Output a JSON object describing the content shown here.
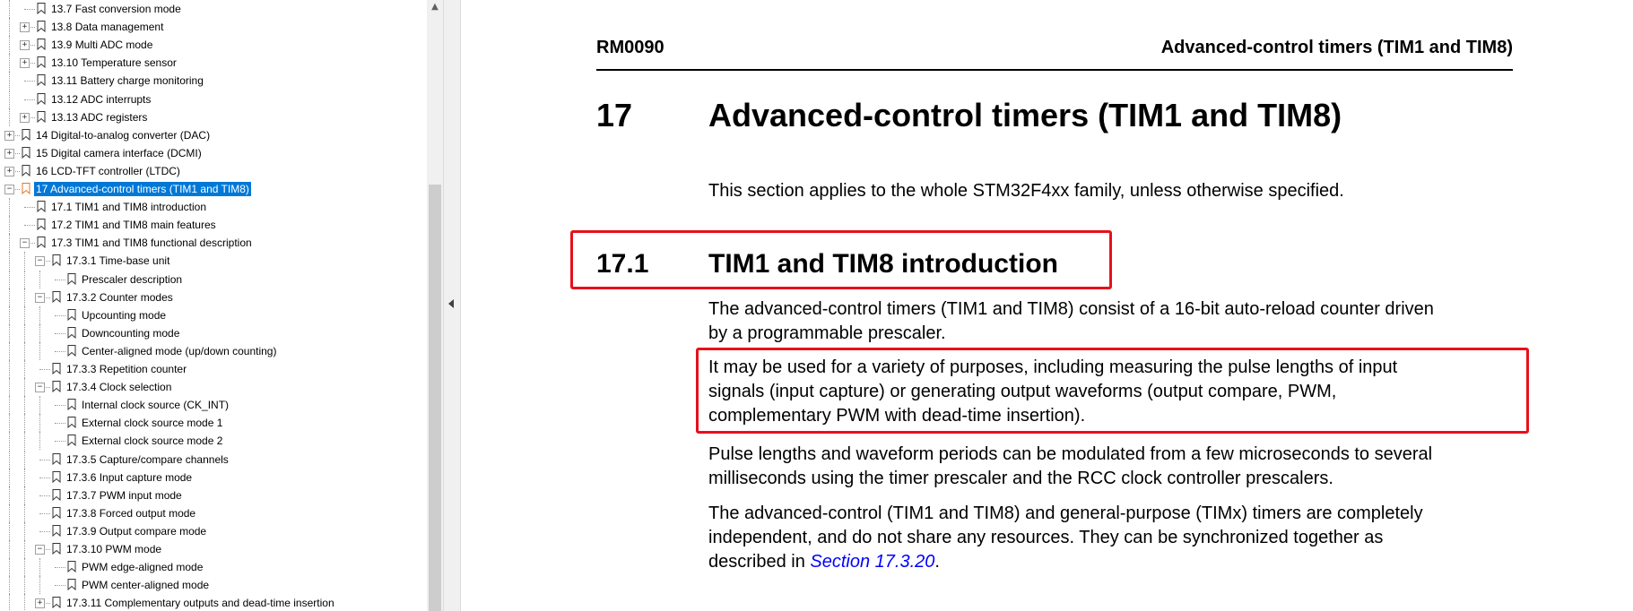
{
  "sidebar": {
    "items": [
      {
        "label": "13.7 Fast conversion mode",
        "level": 2,
        "expandable": false
      },
      {
        "label": "13.8 Data management",
        "level": 2,
        "expandable": true
      },
      {
        "label": "13.9 Multi ADC mode",
        "level": 2,
        "expandable": true
      },
      {
        "label": "13.10 Temperature sensor",
        "level": 2,
        "expandable": true
      },
      {
        "label": "13.11 Battery charge monitoring",
        "level": 2,
        "expandable": false
      },
      {
        "label": "13.12 ADC interrupts",
        "level": 2,
        "expandable": false
      },
      {
        "label": "13.13 ADC registers",
        "level": 2,
        "expandable": true
      },
      {
        "label": "14 Digital-to-analog converter (DAC)",
        "level": 1,
        "expandable": true
      },
      {
        "label": "15 Digital camera interface (DCMI)",
        "level": 1,
        "expandable": true
      },
      {
        "label": "16 LCD-TFT controller (LTDC)",
        "level": 1,
        "expandable": true
      },
      {
        "label": "17 Advanced-control timers (TIM1 and TIM8)",
        "level": 1,
        "expandable": true,
        "expanded": true,
        "selected": true
      },
      {
        "label": "17.1 TIM1 and TIM8 introduction",
        "level": 2,
        "expandable": false
      },
      {
        "label": "17.2 TIM1 and TIM8 main features",
        "level": 2,
        "expandable": false
      },
      {
        "label": "17.3 TIM1 and TIM8 functional description",
        "level": 2,
        "expandable": true,
        "expanded": true
      },
      {
        "label": "17.3.1 Time-base unit",
        "level": 3,
        "expandable": true,
        "expanded": true
      },
      {
        "label": "Prescaler description",
        "level": 4,
        "expandable": false
      },
      {
        "label": "17.3.2 Counter modes",
        "level": 3,
        "expandable": true,
        "expanded": true
      },
      {
        "label": "Upcounting mode",
        "level": 4,
        "expandable": false
      },
      {
        "label": "Downcounting mode",
        "level": 4,
        "expandable": false
      },
      {
        "label": "Center-aligned mode (up/down counting)",
        "level": 4,
        "expandable": false
      },
      {
        "label": "17.3.3 Repetition counter",
        "level": 3,
        "expandable": false
      },
      {
        "label": "17.3.4 Clock selection",
        "level": 3,
        "expandable": true,
        "expanded": true
      },
      {
        "label": "Internal clock source (CK_INT)",
        "level": 4,
        "expandable": false
      },
      {
        "label": "External clock source mode 1",
        "level": 4,
        "expandable": false
      },
      {
        "label": "External clock source mode 2",
        "level": 4,
        "expandable": false
      },
      {
        "label": "17.3.5 Capture/compare channels",
        "level": 3,
        "expandable": false
      },
      {
        "label": "17.3.6 Input capture mode",
        "level": 3,
        "expandable": false
      },
      {
        "label": "17.3.7 PWM input mode",
        "level": 3,
        "expandable": false
      },
      {
        "label": "17.3.8 Forced output mode",
        "level": 3,
        "expandable": false
      },
      {
        "label": "17.3.9 Output compare mode",
        "level": 3,
        "expandable": false
      },
      {
        "label": "17.3.10 PWM mode",
        "level": 3,
        "expandable": true,
        "expanded": true
      },
      {
        "label": "PWM edge-aligned mode",
        "level": 4,
        "expandable": false
      },
      {
        "label": "PWM center-aligned mode",
        "level": 4,
        "expandable": false
      },
      {
        "label": "17.3.11 Complementary outputs and dead-time insertion",
        "level": 3,
        "expandable": true
      }
    ],
    "selected_color": "#0078d7",
    "selected_icon_color": "#e87722"
  },
  "document": {
    "header_left": "RM0090",
    "header_right": "Advanced-control timers (TIM1 and TIM8)",
    "chapter_number": "17",
    "chapter_title": "Advanced-control timers (TIM1 and TIM8)",
    "chapter_intro": "This section applies to the whole STM32F4xx family, unless otherwise specified.",
    "section_number": "17.1",
    "section_title": "TIM1 and TIM8 introduction",
    "paragraphs": {
      "p1": [
        "The advanced-control timers (TIM1 and TIM8) consist of a 16-bit auto-reload counter driven",
        "by a programmable prescaler."
      ],
      "p2": [
        "It may be used for a variety of purposes, including measuring the pulse lengths of input",
        "signals (input capture) or generating output waveforms (output compare, PWM,",
        "complementary PWM with dead-time insertion)."
      ],
      "p3": [
        "Pulse lengths and waveform periods can be modulated from a few microseconds to several",
        "milliseconds using the timer prescaler and the RCC clock controller prescalers."
      ],
      "p4_lines": [
        "The advanced-control (TIM1 and TIM8) and general-purpose (TIMx) timers are completely",
        "independent, and do not share any resources. They can be synchronized together as"
      ],
      "p4_last_prefix": "described in ",
      "p4_link": "Section 17.3.20",
      "p4_last_suffix": "."
    },
    "highlight_color": "#e8101a",
    "link_color": "#0000ff"
  }
}
